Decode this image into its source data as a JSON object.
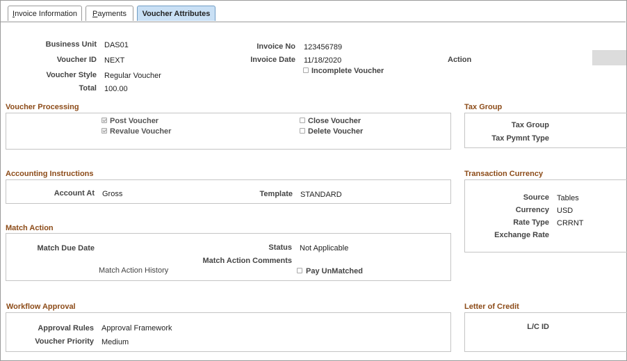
{
  "tabs": [
    {
      "label": "Invoice Information",
      "active": false
    },
    {
      "label": "Payments",
      "active": false
    },
    {
      "label": "Voucher Attributes",
      "active": true
    }
  ],
  "header": {
    "business_unit_label": "Business Unit",
    "business_unit": "DAS01",
    "voucher_id_label": "Voucher ID",
    "voucher_id": "NEXT",
    "voucher_style_label": "Voucher Style",
    "voucher_style": "Regular Voucher",
    "total_label": "Total",
    "total": "100.00",
    "invoice_no_label": "Invoice No",
    "invoice_no": "123456789",
    "invoice_date_label": "Invoice Date",
    "invoice_date": "11/18/2020",
    "incomplete_voucher_label": "Incomplete Voucher",
    "incomplete_voucher": false,
    "action_label": "Action"
  },
  "voucher_processing": {
    "title": "Voucher Processing",
    "post_voucher": {
      "label": "Post Voucher",
      "checked": true,
      "disabled": true
    },
    "revalue_voucher": {
      "label": "Revalue Voucher",
      "checked": true,
      "disabled": true
    },
    "close_voucher": {
      "label": "Close Voucher",
      "checked": false
    },
    "delete_voucher": {
      "label": "Delete Voucher",
      "checked": false
    }
  },
  "tax_group": {
    "title": "Tax Group",
    "tax_group_label": "Tax Group",
    "tax_pymnt_type_label": "Tax Pymnt Type"
  },
  "accounting": {
    "title": "Accounting Instructions",
    "account_at_label": "Account At",
    "account_at": "Gross",
    "template_label": "Template",
    "template": "STANDARD"
  },
  "transaction_currency": {
    "title": "Transaction Currency",
    "source_label": "Source",
    "source": "Tables",
    "currency_label": "Currency",
    "currency": "USD",
    "rate_type_label": "Rate Type",
    "rate_type": "CRRNT",
    "exchange_rate_label": "Exchange Rate"
  },
  "match_action": {
    "title": "Match Action",
    "match_due_date_label": "Match Due Date",
    "status_label": "Status",
    "status": "Not Applicable",
    "comments_label": "Match Action Comments",
    "history_label": "Match Action History",
    "pay_unmatched_label": "Pay UnMatched",
    "pay_unmatched": false
  },
  "workflow": {
    "title": "Workflow Approval",
    "approval_rules_label": "Approval Rules",
    "approval_rules": "Approval Framework",
    "voucher_priority_label": "Voucher Priority",
    "voucher_priority": "Medium"
  },
  "letter_of_credit": {
    "title": "Letter of Credit",
    "lc_id_label": "L/C ID"
  }
}
